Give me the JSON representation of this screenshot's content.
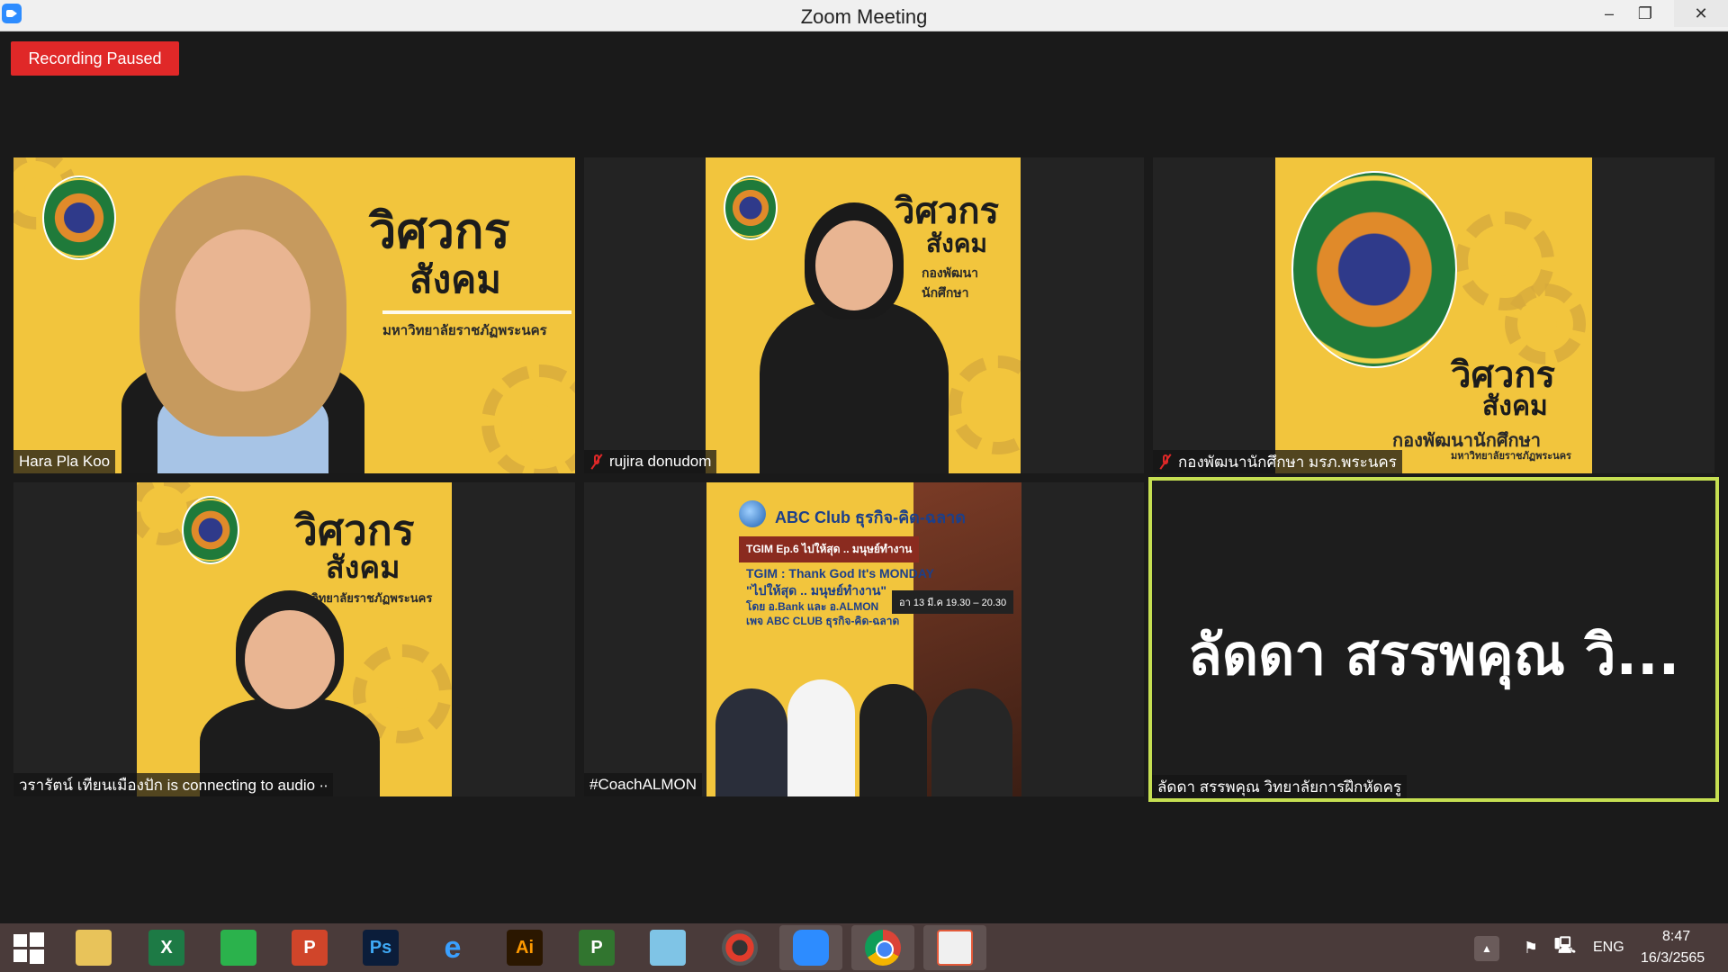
{
  "window": {
    "title": "Zoom Meeting",
    "minimize": "–",
    "maximize": "❐",
    "close": "✕"
  },
  "recording": {
    "label": "Recording Paused"
  },
  "participants": [
    {
      "name": "Hara Pla Koo",
      "muted": false
    },
    {
      "name": "rujira donudom",
      "muted": true
    },
    {
      "name": "กองพัฒนานักศึกษา มรภ.พระนคร",
      "muted": true
    },
    {
      "name": "วรารัตน์ เทียนเมืองปัก is connecting to audio ∙∙",
      "muted": false
    },
    {
      "name": "#CoachALMON",
      "muted": false
    },
    {
      "name": "ลัดดา สรรพคุณ วิทยาลัยการฝึกหัดครู",
      "muted": false,
      "display": "ลัดดา สรรพคุณ วิ...",
      "active_speaker": true
    }
  ],
  "posters": {
    "brand_big_1": "วิศวกร",
    "brand_big_2": "สังคม",
    "university": "มหาวิทยาลัยราชภัฏพระนคร",
    "department": "กองพัฒนานักศึกษา"
  },
  "abc": {
    "title": "ABC Club ธุรกิจ-คิด-ฉลาด",
    "tag": "TGIM Ep.6 ไปให้สุด .. มนุษย์ทำงาน",
    "headline1": "TGIM : Thank God It's MONDAY",
    "headline2": "\"ไปให้สุด .. มนุษย์ทำงาน\"",
    "headline3": "โดย อ.Bank และ อ.ALMON",
    "headline4": "เพจ ABC CLUB ธุรกิจ-คิด-ฉลาด",
    "date": "อา 13 มี.ค 19.30 – 20.30"
  },
  "taskbar": {
    "icons": [
      "windows-start-icon",
      "file-explorer-icon",
      "excel-icon",
      "publisher-store-icon",
      "powerpoint-icon",
      "photoshop-icon",
      "internet-explorer-icon",
      "illustrator-icon",
      "project-icon",
      "notepad-icon",
      "photoscape-icon",
      "zoom-icon",
      "chrome-icon",
      "paint-icon"
    ],
    "labels": {
      "excel": "X",
      "ps": "Ps",
      "ai": "Ai",
      "ppt": "P",
      "proj": "P"
    },
    "lang": "ENG",
    "time": "8:47",
    "date": "16/3/2565"
  },
  "colors": {
    "accent_active": "#c6df52",
    "recording": "#e02828",
    "poster_yellow": "#f2c53d"
  }
}
